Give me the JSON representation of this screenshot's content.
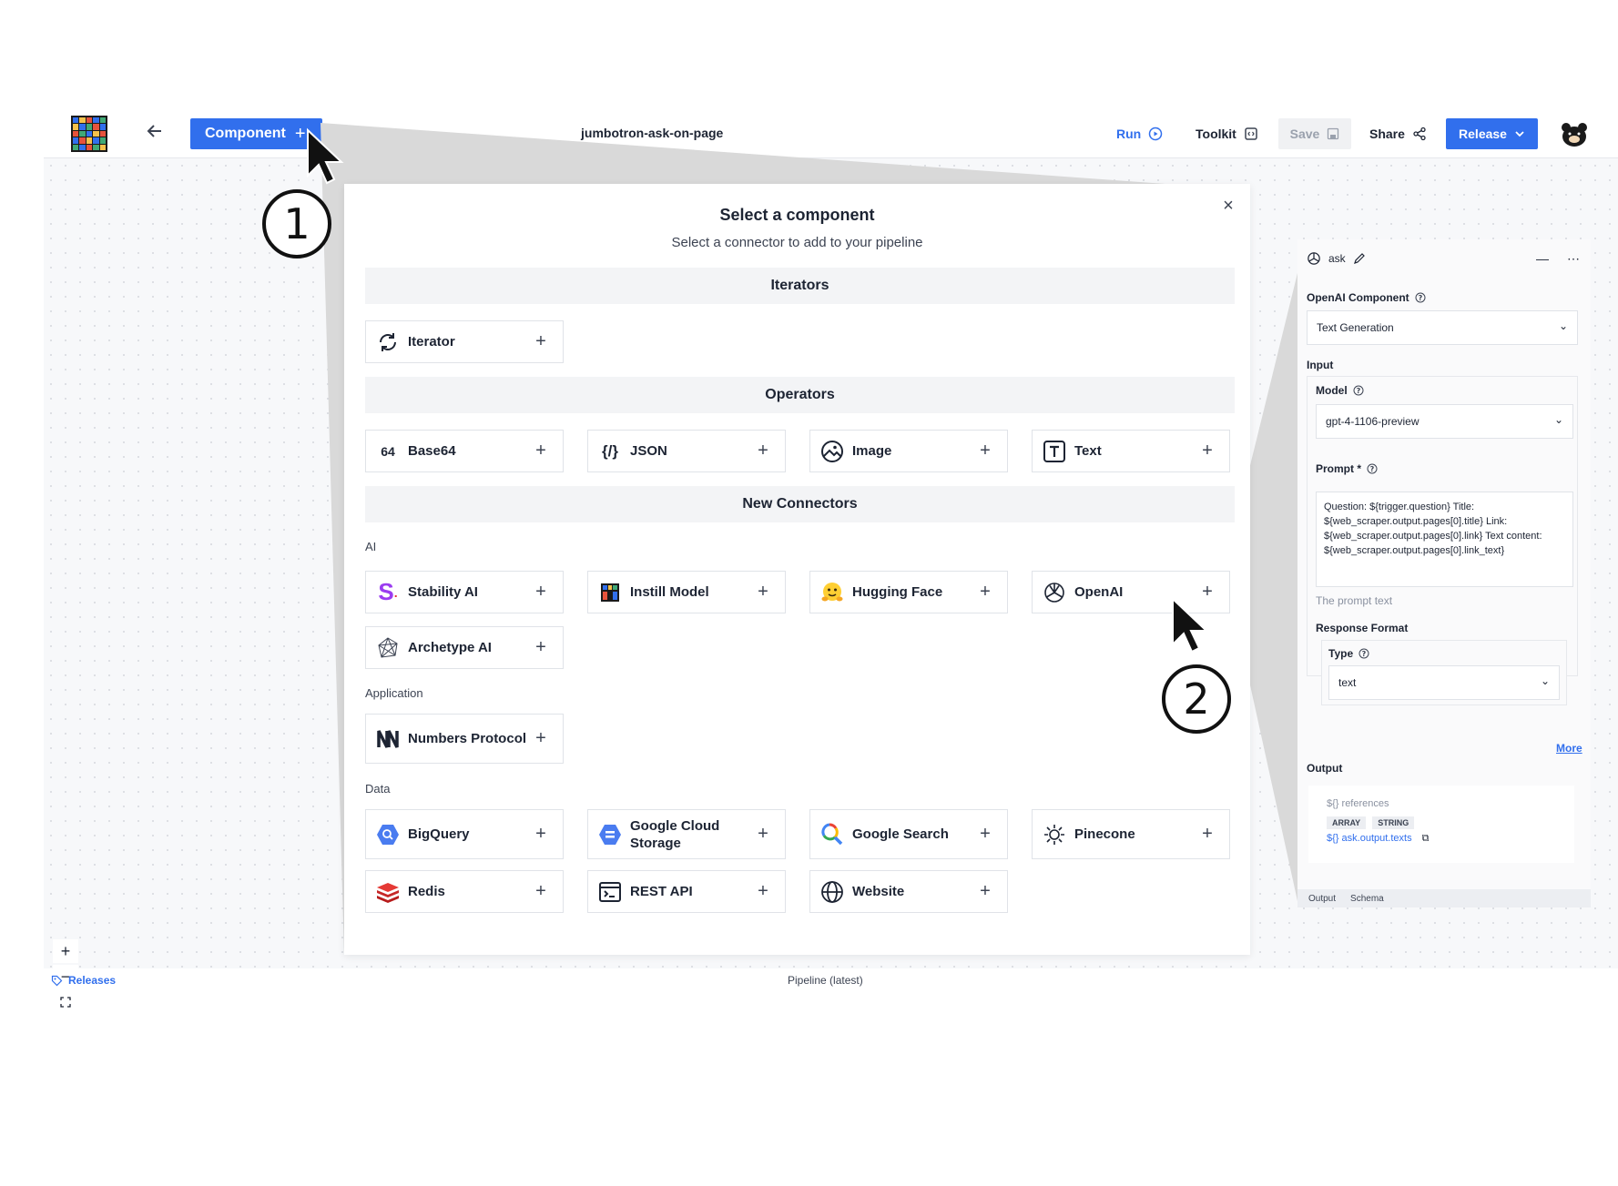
{
  "topbar": {
    "component_button": "Component",
    "pipeline_name": "jumbotron-ask-on-page",
    "run": "Run",
    "toolkit": "Toolkit",
    "save": "Save",
    "share": "Share",
    "release": "Release"
  },
  "footer": {
    "releases": "Releases",
    "pipeline_version": "Pipeline (latest)"
  },
  "modal": {
    "title": "Select a component",
    "subtitle": "Select a connector to add to your pipeline",
    "sections": {
      "iterators": "Iterators",
      "operators": "Operators",
      "new_connectors": "New Connectors"
    },
    "groups": {
      "ai": "AI",
      "application": "Application",
      "data": "Data"
    },
    "items": {
      "iterator": "Iterator",
      "base64": "Base64",
      "json": "JSON",
      "image": "Image",
      "text": "Text",
      "stability_ai": "Stability AI",
      "instill_model": "Instill Model",
      "hugging_face": "Hugging Face",
      "openai": "OpenAI",
      "archetype_ai": "Archetype AI",
      "numbers_protocol": "Numbers Protocol",
      "bigquery": "BigQuery",
      "google_cloud_storage": "Google Cloud Storage",
      "google_search": "Google Search",
      "pinecone": "Pinecone",
      "redis": "Redis",
      "rest_api": "REST API",
      "website": "Website"
    }
  },
  "panel": {
    "node_name": "ask",
    "component_label": "OpenAI Component",
    "component_value": "Text Generation",
    "input_label": "Input",
    "model_label": "Model",
    "model_value": "gpt-4-1106-preview",
    "prompt_label": "Prompt *",
    "prompt_value": "Question: ${trigger.question} Title: ${web_scraper.output.pages[0].title} Link: ${web_scraper.output.pages[0].link} Text content: ${web_scraper.output.pages[0].link_text}",
    "prompt_hint": "The prompt text",
    "response_format_label": "Response Format",
    "type_label": "Type",
    "type_value": "text",
    "more": "More",
    "output_label": "Output",
    "references": "references",
    "tag_array": "ARRAY",
    "tag_string": "STRING",
    "output_ref": "ask.output.texts",
    "tab_output": "Output",
    "tab_schema": "Schema"
  },
  "markers": {
    "one": "1",
    "two": "2"
  },
  "colors": {
    "accent": "#316fed",
    "canvas": "#f7f8fa",
    "stability": "#9b3cf0"
  }
}
